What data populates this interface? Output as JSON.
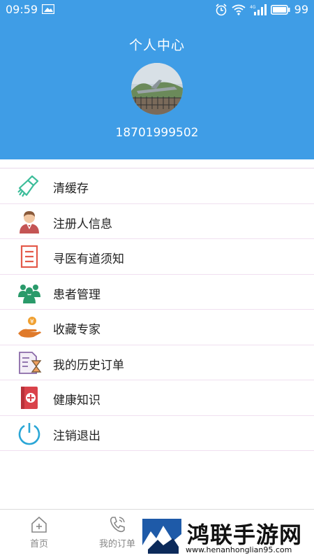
{
  "status_bar": {
    "time": "09:59",
    "battery": "99",
    "network": "4G"
  },
  "header": {
    "title": "个人中心",
    "phone": "18701999502"
  },
  "menu": [
    {
      "label": "清缓存",
      "icon": "broom-icon"
    },
    {
      "label": "注册人信息",
      "icon": "person-icon"
    },
    {
      "label": "寻医有道须知",
      "icon": "document-icon"
    },
    {
      "label": "患者管理",
      "icon": "group-icon"
    },
    {
      "label": "收藏专家",
      "icon": "hand-coin-icon"
    },
    {
      "label": "我的历史订单",
      "icon": "history-order-icon"
    },
    {
      "label": "健康知识",
      "icon": "medical-book-icon"
    },
    {
      "label": "注销退出",
      "icon": "power-icon"
    }
  ],
  "bottom_nav": [
    {
      "label": "首页",
      "icon": "home-plus-icon"
    },
    {
      "label": "我的订单",
      "icon": "phone-icon"
    }
  ],
  "watermark": {
    "text": "鸿联手游网",
    "url": "www.henanhonglian95.com"
  },
  "colors": {
    "header_bg": "#3f9de6",
    "divider": "#f0dff0"
  }
}
